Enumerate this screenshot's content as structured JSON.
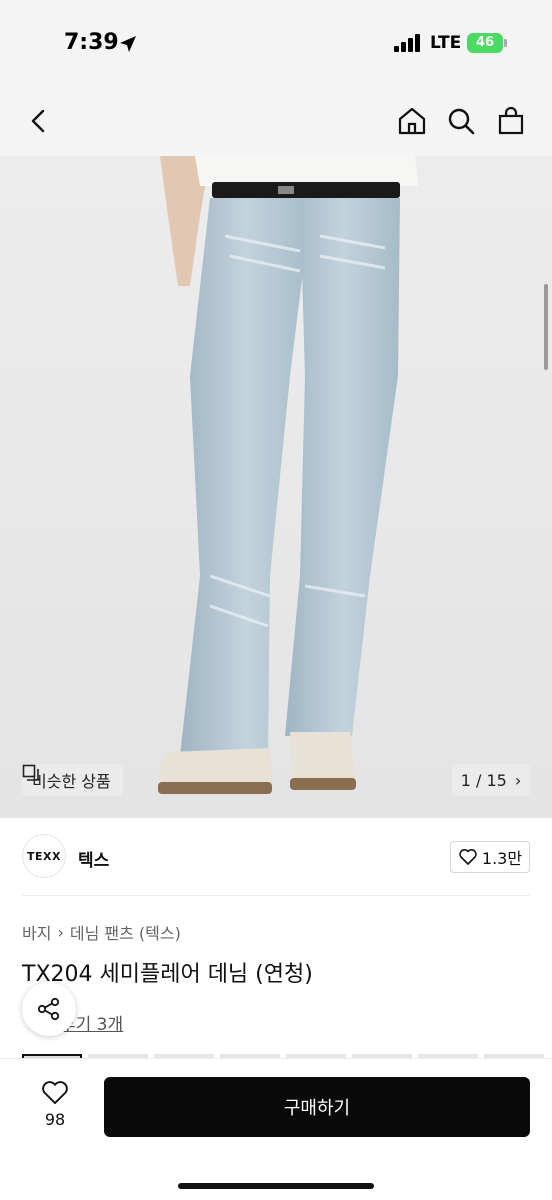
{
  "status_bar": {
    "time": "7:39",
    "network": "LTE",
    "battery": "46"
  },
  "nav": {
    "back_icon": "chevron-left-icon",
    "home_icon": "home-icon",
    "search_icon": "search-icon",
    "bag_icon": "shopping-bag-icon"
  },
  "gallery": {
    "similar_label": "비슷한 상품",
    "counter": "1 / 15",
    "colors": {
      "denim_light": "#b9cbd6",
      "denim_mid": "#9fb6c5",
      "shirt": "#f6f6f4",
      "belt": "#1a1a1a",
      "shoe": "#e7e1d6",
      "sole": "#8a6e52"
    }
  },
  "brand": {
    "logo_text": "TEXX",
    "name": "텍스",
    "likes": "1.3만"
  },
  "breadcrumb": [
    "바지",
    "데님 팬츠 (텍스)"
  ],
  "product": {
    "title": "TX204 세미플레어 데님 (연청)",
    "reviews": "후기 3개"
  },
  "bottom": {
    "wish_count": "98",
    "buy_label": "구매하기"
  }
}
